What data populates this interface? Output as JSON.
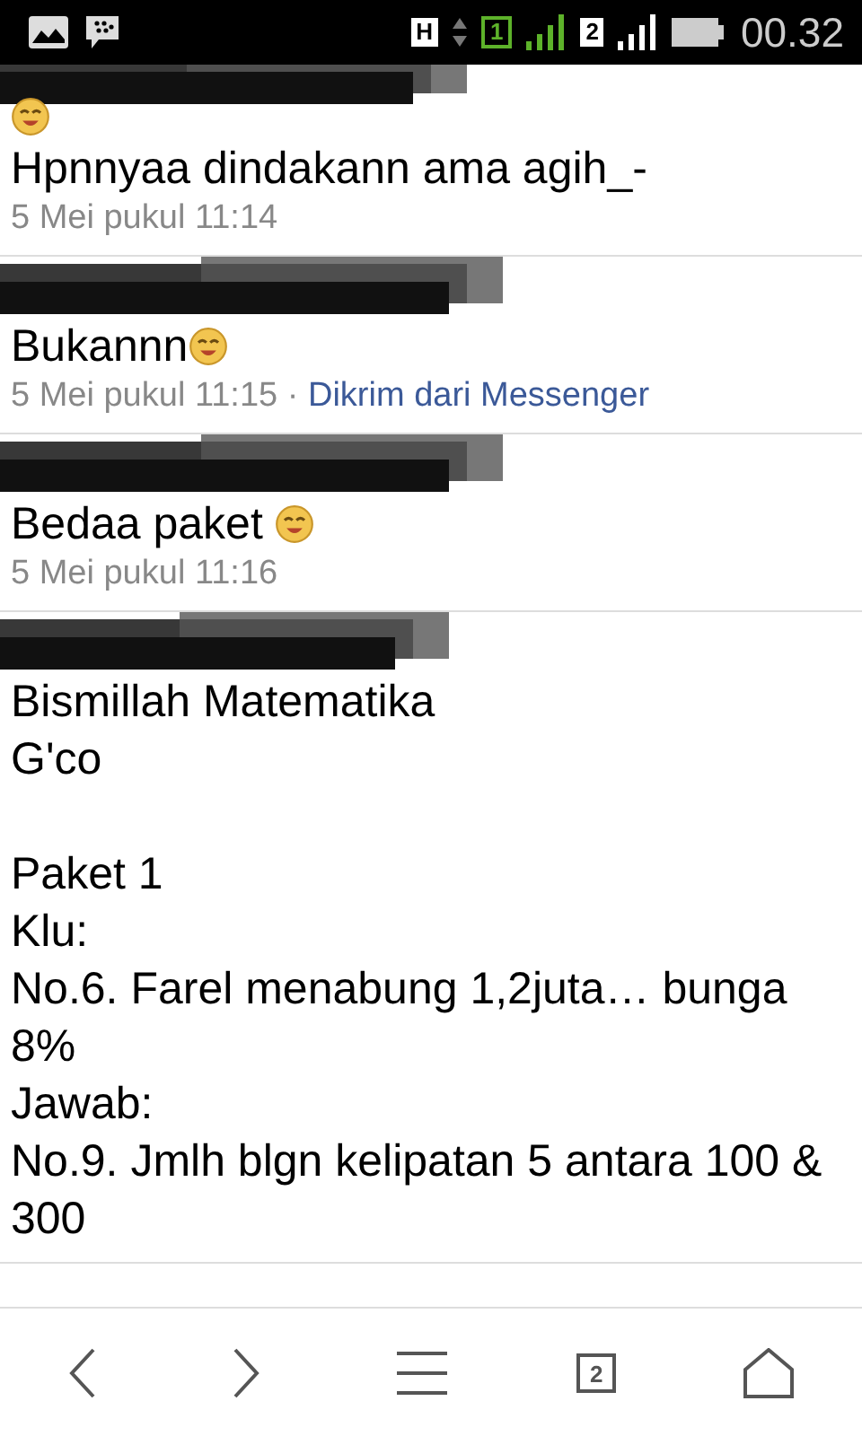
{
  "status_bar": {
    "network": "H",
    "sim_1": "1",
    "sim_2": "2",
    "time": "00.32"
  },
  "messages": [
    {
      "emoji_above": true,
      "text": "Hpnnyaa dindakann ama agih_-",
      "time": "5 Mei pukul 11:14"
    },
    {
      "emoji_after": true,
      "text": "Bukannn",
      "time": "5 Mei pukul 11:15",
      "separator": "·",
      "via": "Dikrim dari Messenger"
    },
    {
      "emoji_after": true,
      "text": "Bedaa paket ",
      "time": "5 Mei pukul 11:16"
    },
    {
      "text": "Bismillah Matematika\nG'co\n\nPaket 1\nKlu:\nNo.6. Farel menabung 1,2juta… bunga 8%\nJawab:\nNo.9. Jmlh blgn kelipatan 5 antara 100 & 300"
    }
  ],
  "nav_bar": {
    "tab_count": "2"
  }
}
